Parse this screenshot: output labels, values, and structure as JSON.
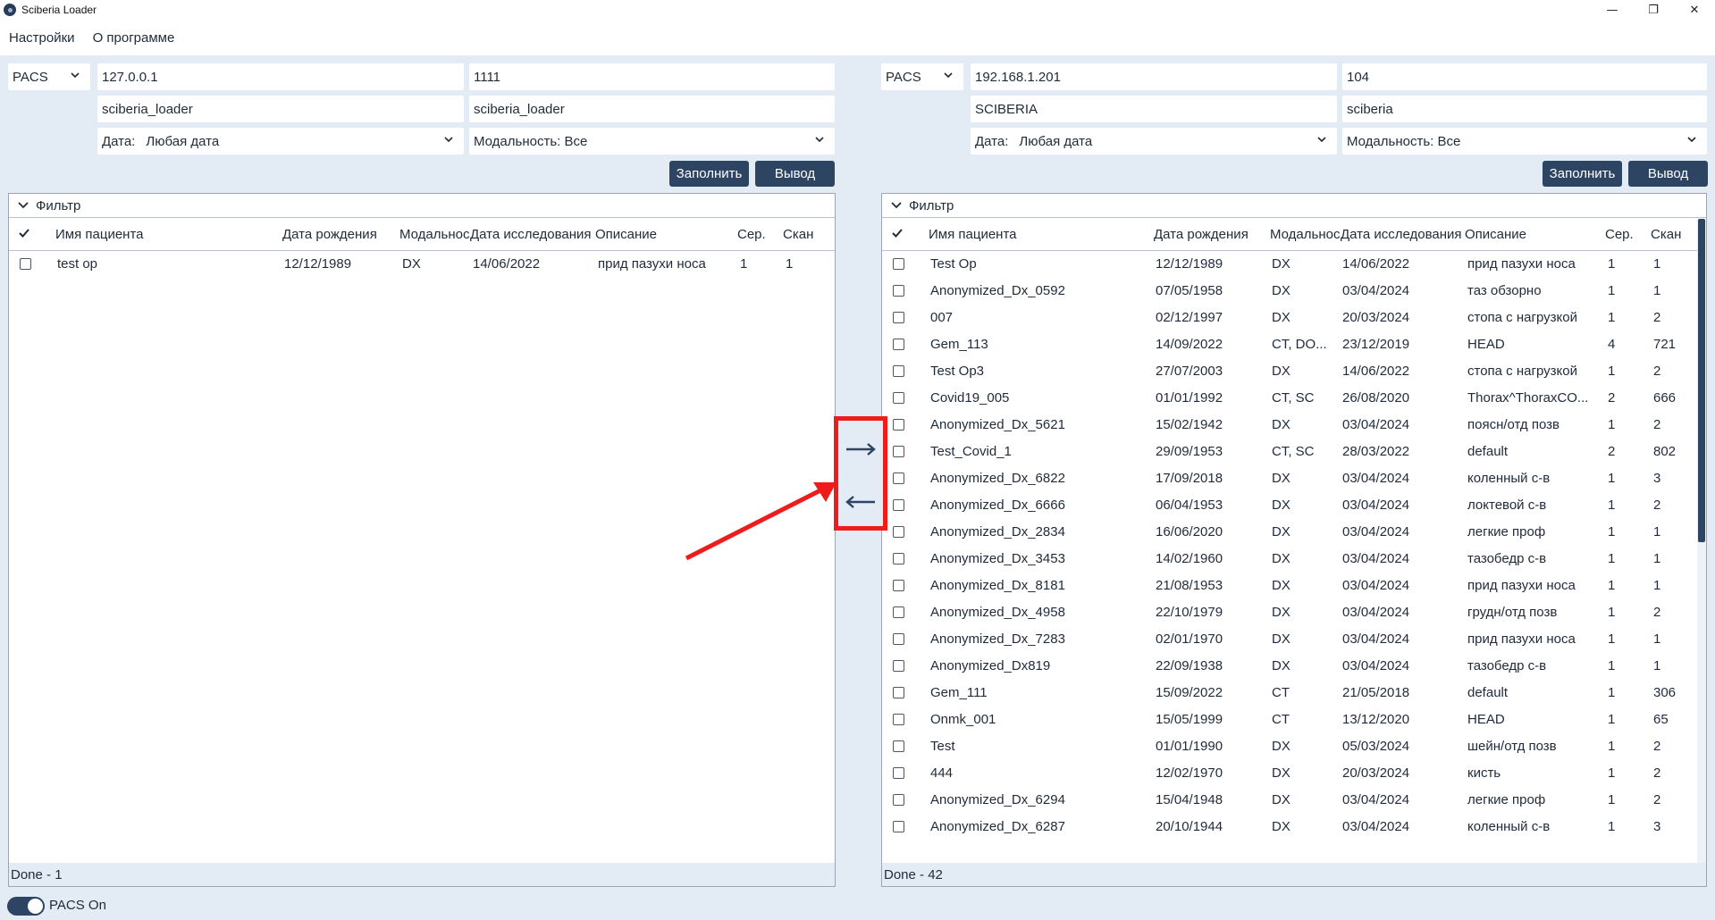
{
  "app": {
    "title": "Sciberia Loader"
  },
  "window_controls": {
    "minimize": "—",
    "maximize": "❐",
    "close": "✕"
  },
  "menu": {
    "settings": "Настройки",
    "about": "О программе"
  },
  "left": {
    "source": "PACS",
    "host": "127.0.0.1",
    "port": "1111",
    "aet": "sciberia_loader",
    "aec": "sciberia_loader",
    "date_label": "Дата:",
    "date_value": "Любая дата",
    "modality": "Модальность: Все",
    "fill_button": "Заполнить",
    "output_button": "Вывод",
    "filter": "Фильтр",
    "status": "Done - 1",
    "rows": [
      [
        "test op",
        "12/12/1989",
        "DX",
        "14/06/2022",
        "прид пазухи носа",
        "1",
        "1"
      ]
    ]
  },
  "right": {
    "source": "PACS",
    "host": "192.168.1.201",
    "port": "104",
    "aet": "SCIBERIA",
    "aec": "sciberia",
    "date_label": "Дата:",
    "date_value": "Любая дата",
    "modality": "Модальность: Все",
    "fill_button": "Заполнить",
    "output_button": "Вывод",
    "filter": "Фильтр",
    "status": "Done - 42",
    "rows": [
      [
        "Test Op",
        "12/12/1989",
        "DX",
        "14/06/2022",
        "прид пазухи носа",
        "1",
        "1"
      ],
      [
        "Anonymized_Dx_0592",
        "07/05/1958",
        "DX",
        "03/04/2024",
        "таз обзорно",
        "1",
        "1"
      ],
      [
        "007",
        "02/12/1997",
        "DX",
        "20/03/2024",
        "стопа с нагрузкой",
        "1",
        "2"
      ],
      [
        "Gem_113",
        "14/09/2022",
        "CT, DO...",
        "23/12/2019",
        "HEAD",
        "4",
        "721"
      ],
      [
        "Test Op3",
        "27/07/2003",
        "DX",
        "14/06/2022",
        "стопа с нагрузкой",
        "1",
        "2"
      ],
      [
        "Covid19_005",
        "01/01/1992",
        "CT, SC",
        "26/08/2020",
        "Thorax^ThoraxCO...",
        "2",
        "666"
      ],
      [
        "Anonymized_Dx_5621",
        "15/02/1942",
        "DX",
        "03/04/2024",
        "поясн/отд позв",
        "1",
        "2"
      ],
      [
        "Test_Covid_1",
        "29/09/1953",
        "CT, SC",
        "28/03/2022",
        "default",
        "2",
        "802"
      ],
      [
        "Anonymized_Dx_6822",
        "17/09/2018",
        "DX",
        "03/04/2024",
        "коленный с-в",
        "1",
        "3"
      ],
      [
        "Anonymized_Dx_6666",
        "06/04/1953",
        "DX",
        "03/04/2024",
        "локтевой с-в",
        "1",
        "2"
      ],
      [
        "Anonymized_Dx_2834",
        "16/06/2020",
        "DX",
        "03/04/2024",
        "легкие проф",
        "1",
        "1"
      ],
      [
        "Anonymized_Dx_3453",
        "14/02/1960",
        "DX",
        "03/04/2024",
        "тазобедр с-в",
        "1",
        "1"
      ],
      [
        "Anonymized_Dx_8181",
        "21/08/1953",
        "DX",
        "03/04/2024",
        "прид пазухи носа",
        "1",
        "1"
      ],
      [
        "Anonymized_Dx_4958",
        "22/10/1979",
        "DX",
        "03/04/2024",
        "грудн/отд позв",
        "1",
        "2"
      ],
      [
        "Anonymized_Dx_7283",
        "02/01/1970",
        "DX",
        "03/04/2024",
        "прид пазухи носа",
        "1",
        "1"
      ],
      [
        "Anonymized_Dx819",
        "22/09/1938",
        "DX",
        "03/04/2024",
        "тазобедр с-в",
        "1",
        "1"
      ],
      [
        "Gem_111",
        "15/09/2022",
        "CT",
        "21/05/2018",
        "default",
        "1",
        "306"
      ],
      [
        "Onmk_001",
        "15/05/1999",
        "CT",
        "13/12/2020",
        "HEAD",
        "1",
        "65"
      ],
      [
        "Test",
        "01/01/1990",
        "DX",
        "05/03/2024",
        "шейн/отд позв",
        "1",
        "2"
      ],
      [
        "444",
        "12/02/1970",
        "DX",
        "20/03/2024",
        "кисть",
        "1",
        "2"
      ],
      [
        "Anonymized_Dx_6294",
        "15/04/1948",
        "DX",
        "03/04/2024",
        "легкие проф",
        "1",
        "2"
      ],
      [
        "Anonymized_Dx_6287",
        "20/10/1944",
        "DX",
        "03/04/2024",
        "коленный с-в",
        "1",
        "3"
      ]
    ]
  },
  "columns": [
    "Имя пациента",
    "Дата рождения",
    "Модальность",
    "Дата исследования",
    "Описание",
    "Сер.",
    "Скан"
  ],
  "footer": {
    "pacs_toggle": "PACS On",
    "pacs_on": true
  },
  "colors": {
    "accent": "#2d4463",
    "highlight": "#ef1c1c",
    "background": "#e3ebf5"
  },
  "icons": {
    "to_right": "arrow-right-icon",
    "to_left": "arrow-left-icon",
    "check_all": "check-icon",
    "filter": "chevron-down-icon"
  }
}
